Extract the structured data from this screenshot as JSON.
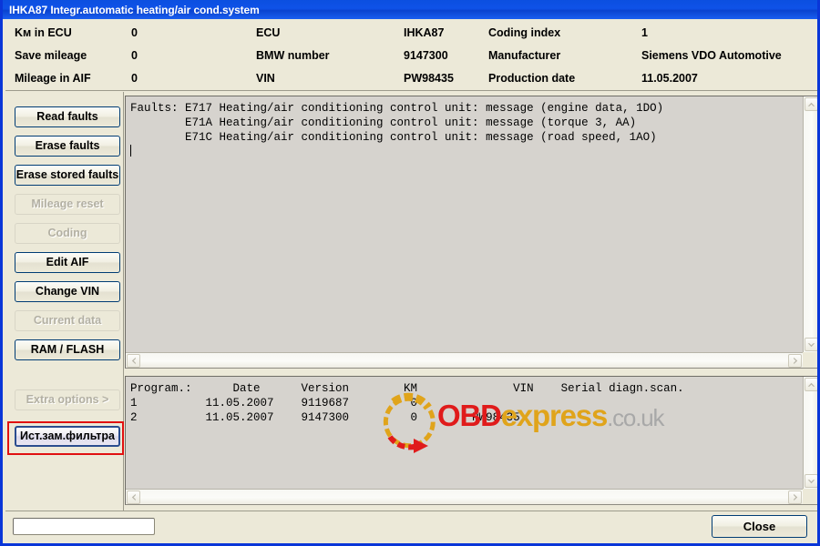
{
  "window": {
    "title": "IHKA87 Integr.automatic heating/air cond.system"
  },
  "info_header": {
    "rows": [
      {
        "label1": "Kм in ECU",
        "value1": "0",
        "label2": "ECU",
        "value2": "IHKA87",
        "label3": "Coding index",
        "value3": "1"
      },
      {
        "label1": "Save mileage",
        "value1": "0",
        "label2": "BMW number",
        "value2": "9147300",
        "label3": "Manufacturer",
        "value3": "Siemens VDO Automotive"
      },
      {
        "label1": "Mileage in AIF",
        "value1": "0",
        "label2": "VIN",
        "value2": "PW98435",
        "label3": "Production date",
        "value3": "11.05.2007"
      }
    ]
  },
  "sidebar": {
    "buttons": [
      {
        "label": "Read faults",
        "state": "enabled"
      },
      {
        "label": "Erase faults",
        "state": "enabled"
      },
      {
        "label": "Erase stored faults",
        "state": "enabled"
      },
      {
        "label": "Mileage reset",
        "state": "disabled"
      },
      {
        "label": "Coding",
        "state": "disabled"
      },
      {
        "label": "Edit AIF",
        "state": "enabled"
      },
      {
        "label": "Change VIN",
        "state": "enabled"
      },
      {
        "label": "Current data",
        "state": "disabled"
      },
      {
        "label": "RAM / FLASH",
        "state": "enabled"
      },
      {
        "label": "Extra options >",
        "state": "disabled"
      },
      {
        "label": "Ист.зам.фильтра",
        "state": "focused"
      }
    ]
  },
  "faults_panel": {
    "lines": [
      "Faults: E717 Heating/air conditioning control unit: message (engine data, 1DO)",
      "        E71A Heating/air conditioning control unit: message (torque 3, AA)",
      "        E71C Heating/air conditioning control unit: message (road speed, 1AO)"
    ]
  },
  "history_panel": {
    "header": "Program.:      Date      Version        KM              VIN    Serial diagn.scan.",
    "rows": [
      "1          11.05.2007    9119687         0",
      "2          11.05.2007    9147300         0        PW98435"
    ]
  },
  "watermark": {
    "part1": "OBD",
    "part2": "express",
    "part3": ".co.uk"
  },
  "footer": {
    "status_value": "",
    "status_placeholder": "",
    "close_label": "Close"
  },
  "colors": {
    "titlebar": "#0f52e8",
    "window_border": "#0a36d8",
    "face": "#ece9d8",
    "panel_face": "#d6d3ce",
    "highlight_box": "#e01010",
    "watermark_red": "#e01b1b",
    "watermark_gold": "#e0a41b"
  }
}
